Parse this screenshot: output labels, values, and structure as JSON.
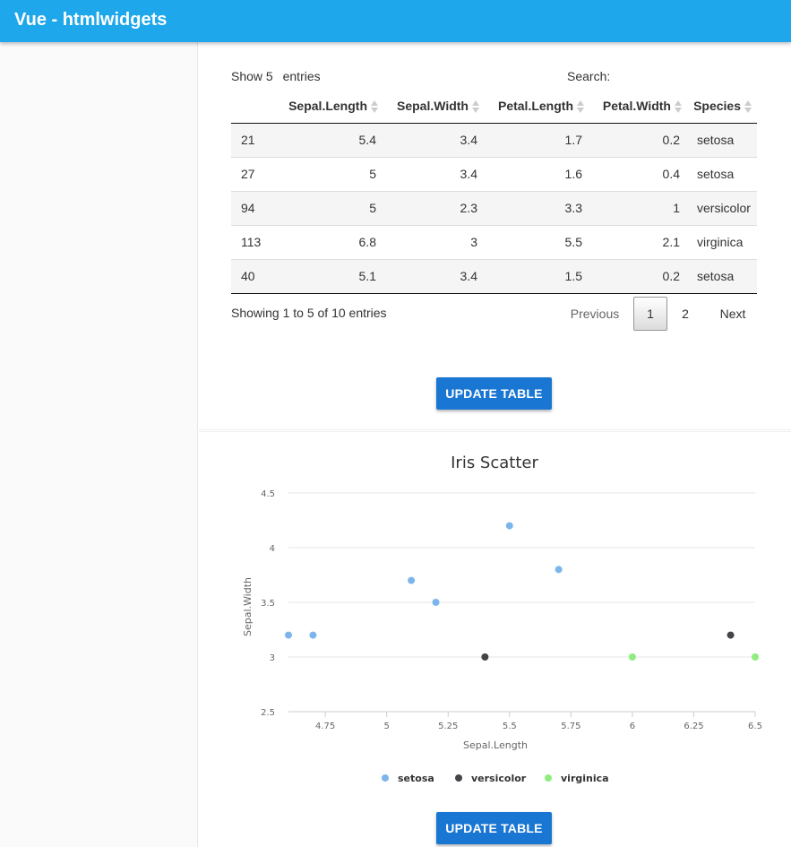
{
  "app": {
    "title": "Vue - htmlwidgets"
  },
  "table_widget": {
    "length_label": "Show",
    "length_value": "5",
    "length_suffix": "entries",
    "search_label": "Search:",
    "columns": [
      "",
      "Sepal.Length",
      "Sepal.Width",
      "Petal.Length",
      "Petal.Width",
      "Species"
    ],
    "rows": [
      [
        "21",
        "5.4",
        "3.4",
        "1.7",
        "0.2",
        "setosa"
      ],
      [
        "27",
        "5",
        "3.4",
        "1.6",
        "0.4",
        "setosa"
      ],
      [
        "94",
        "5",
        "2.3",
        "3.3",
        "1",
        "versicolor"
      ],
      [
        "113",
        "6.8",
        "3",
        "5.5",
        "2.1",
        "virginica"
      ],
      [
        "40",
        "5.1",
        "3.4",
        "1.5",
        "0.2",
        "setosa"
      ]
    ],
    "info": "Showing 1 to 5 of 10 entries",
    "pager": {
      "previous": "Previous",
      "pages": [
        "1",
        "2"
      ],
      "current": "1",
      "next": "Next"
    },
    "update_button": "UPDATE TABLE"
  },
  "chart_widget": {
    "update_button": "UPDATE TABLE"
  },
  "chart_data": {
    "type": "scatter",
    "title": "Iris Scatter",
    "xlabel": "Sepal.Length",
    "ylabel": "Sepal.Width",
    "xlim": [
      4.6,
      6.5
    ],
    "ylim": [
      2.5,
      4.5
    ],
    "x_ticks": [
      "4.75",
      "5",
      "5.25",
      "5.5",
      "5.75",
      "6",
      "6.25",
      "6.5"
    ],
    "y_ticks": [
      "2.5",
      "3",
      "3.5",
      "4",
      "4.5"
    ],
    "grid": true,
    "legend_position": "bottom",
    "series": [
      {
        "name": "setosa",
        "color": "#7cb5ec",
        "points": [
          [
            4.6,
            3.2
          ],
          [
            4.7,
            3.2
          ],
          [
            5.1,
            3.7
          ],
          [
            5.2,
            3.5
          ],
          [
            5.5,
            4.2
          ],
          [
            5.7,
            3.8
          ]
        ]
      },
      {
        "name": "versicolor",
        "color": "#434348",
        "points": [
          [
            5.4,
            3.0
          ],
          [
            6.4,
            3.2
          ]
        ]
      },
      {
        "name": "virginica",
        "color": "#90ed7d",
        "points": [
          [
            6.0,
            3.0
          ],
          [
            6.5,
            3.0
          ]
        ]
      }
    ]
  },
  "colors": {
    "toolbar": "#1ea7ea",
    "button": "#1976d2"
  }
}
